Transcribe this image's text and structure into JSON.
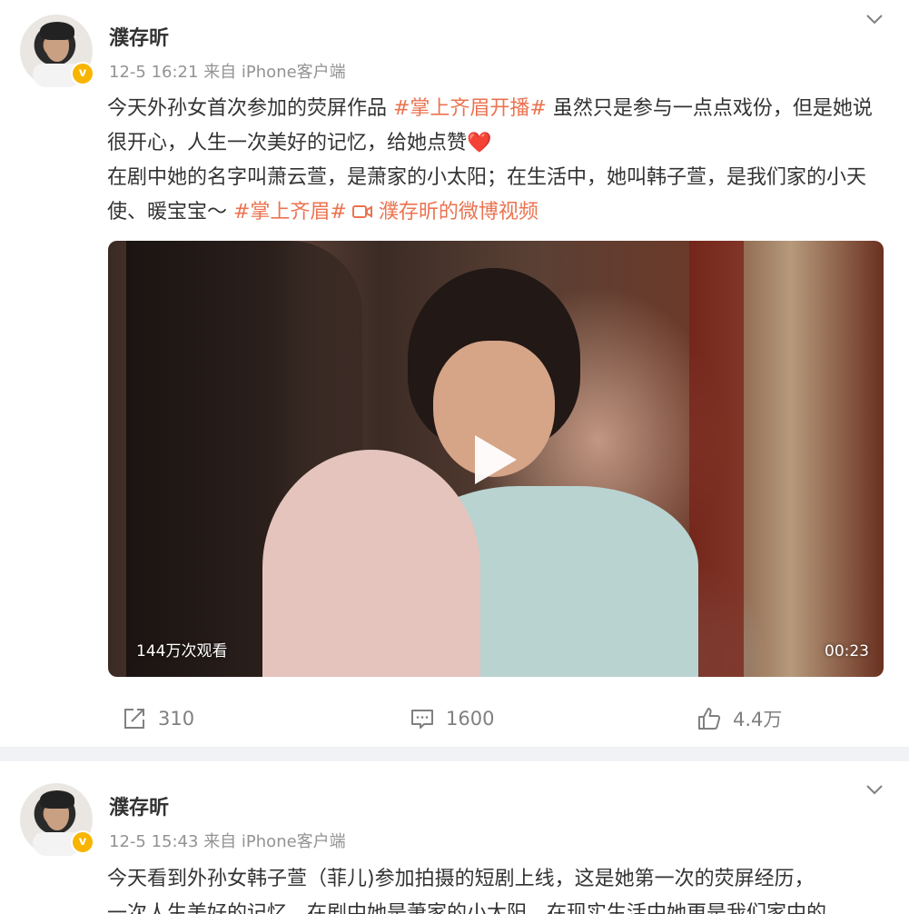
{
  "posts": [
    {
      "username": "濮存昕",
      "time": "12-5 16:21",
      "source_prefix": "来自",
      "source": "iPhone客户端",
      "verified_badge": "v",
      "text": {
        "p1a": "今天外孙女首次参加的荧屏作品 ",
        "tag1": "#掌上齐眉开播#",
        "p1b": " 虽然只是参与一点点戏份，但是她说很开心，人生一次美好的记忆，给她点赞",
        "heart": "❤️",
        "p2a": "在剧中她的名字叫萧云萱，是萧家的小太阳；在生活中，她叫韩子萱，是我们家的小天使、暖宝宝～ ",
        "tag2": "#掌上齐眉#",
        "video_link": " 濮存昕的微博视频"
      },
      "video": {
        "views": "144万次观看",
        "duration": "00:23"
      },
      "actions": {
        "repost": "310",
        "comment": "1600",
        "like": "4.4万"
      }
    },
    {
      "username": "濮存昕",
      "time": "12-5 15:43",
      "source_prefix": "来自",
      "source": "iPhone客户端",
      "verified_badge": "v",
      "text": {
        "line1": "今天看到外孙女韩子萱（菲儿)参加拍摄的短剧上线，这是她第一次的荧屏经历，",
        "line2": "一次人生美好的记忆，在剧中她是萧家的小太阳，在现实生活中她更是我们家中的"
      }
    }
  ],
  "colors": {
    "accent": "#eb7350",
    "verified": "#f7b500",
    "divider": "#f1f2f5",
    "meta": "#939393"
  },
  "icons": [
    "chevron-down-icon",
    "repost-icon",
    "comment-icon",
    "like-icon",
    "play-icon",
    "video-link-icon",
    "verified-icon"
  ]
}
